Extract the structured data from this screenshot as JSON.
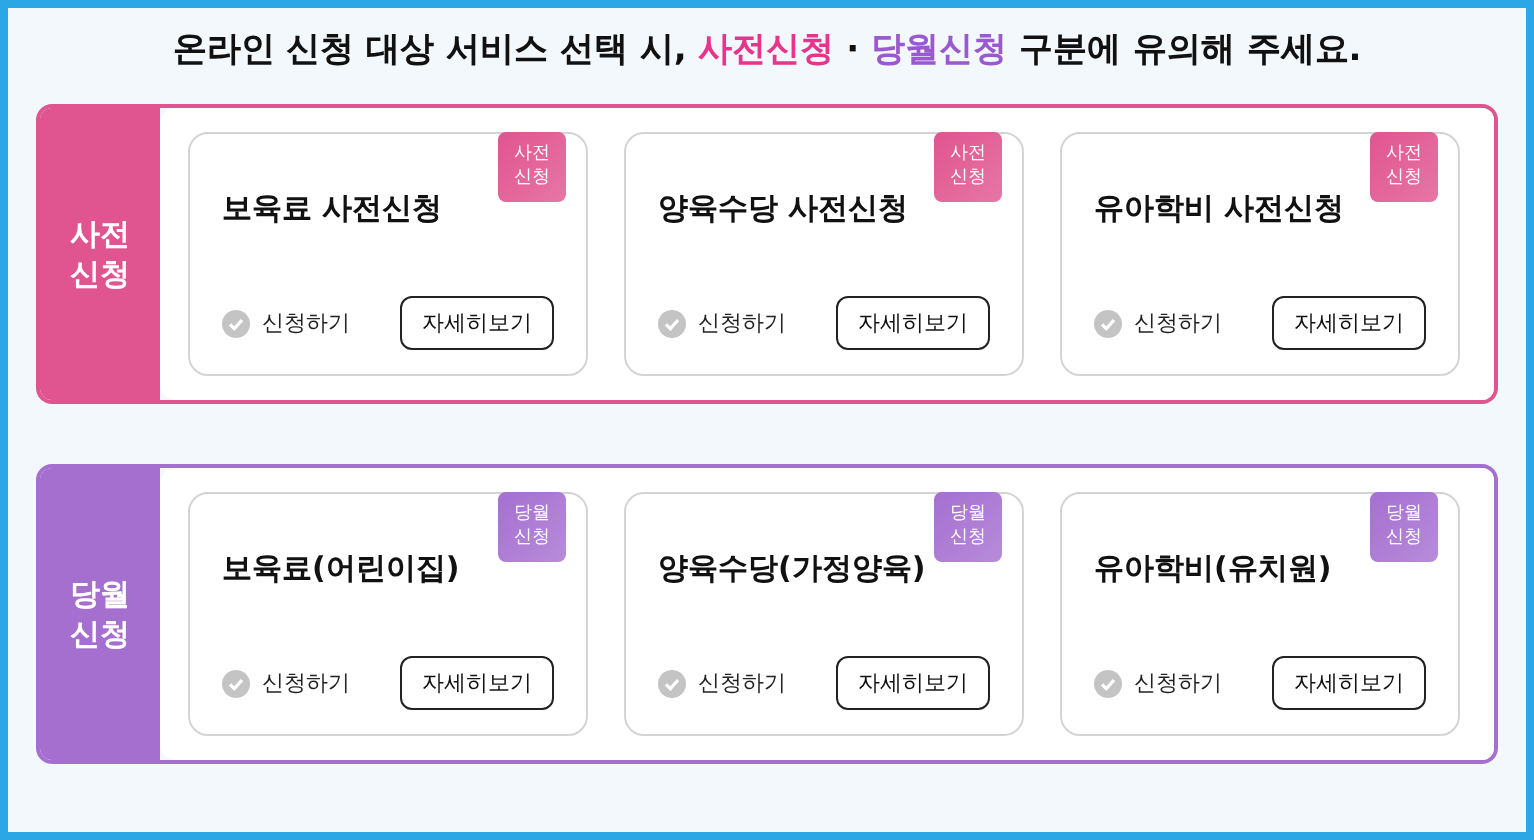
{
  "headline": [
    {
      "text": "온라인 신청 대상 서비스 선택 시, "
    },
    {
      "text": "사전신청",
      "color": "#e8348c"
    },
    {
      "text": " · "
    },
    {
      "text": "당월신청",
      "color": "#9b59d0"
    },
    {
      "text": " 구분에 유의해 주세요."
    }
  ],
  "sections": [
    {
      "label": "사전 신청",
      "color": "#e0548f",
      "cards": [
        {
          "title": "보육료 사전신청",
          "badge": "사전 신청",
          "apply": {
            "label": "신청하기",
            "checked": false
          },
          "button": "자세히보기"
        },
        {
          "title": "양육수당 사전신청",
          "badge": "사전 신청",
          "apply": {
            "label": "신청하기",
            "checked": false
          },
          "button": "자세히보기"
        },
        {
          "title": "유아학비 사전신청",
          "badge": "사전 신청",
          "apply": {
            "label": "신청하기",
            "checked": false
          },
          "button": "자세히보기"
        }
      ]
    },
    {
      "label": "당월 신청",
      "color": "#a56fd0",
      "cards": [
        {
          "title": "보육료(어린이집)",
          "badge": "당월 신청",
          "apply": {
            "label": "신청하기",
            "checked": false
          },
          "button": "자세히보기"
        },
        {
          "title": "양육수당(가정양육)",
          "badge": "당월 신청",
          "apply": {
            "label": "신청하기",
            "checked": false
          },
          "button": "자세히보기"
        },
        {
          "title": "유아학비(유치원)",
          "badge": "당월 신청",
          "apply": {
            "label": "신청하기",
            "checked": false
          },
          "button": "자세히보기"
        }
      ]
    }
  ]
}
